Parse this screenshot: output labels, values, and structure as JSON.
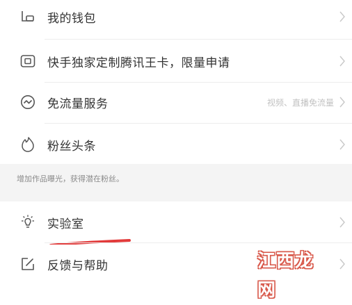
{
  "menu_top": {
    "items": [
      {
        "label": "我的钱包",
        "icon": "wallet-icon",
        "right_text": ""
      },
      {
        "label": "快手独家定制腾讯王卡，限量申请",
        "icon": "sim-card-icon",
        "right_text": ""
      },
      {
        "label": "免流量服务",
        "icon": "wave-circle-icon",
        "right_text": "视频、直播免流量"
      },
      {
        "label": "粉丝头条",
        "icon": "flame-icon",
        "right_text": ""
      }
    ]
  },
  "section_note": "增加作品曝光，获得潜在粉丝。",
  "menu_bottom": {
    "items": [
      {
        "label": "实验室",
        "icon": "lightbulb-icon"
      },
      {
        "label": "反馈与帮助",
        "icon": "edit-icon"
      }
    ]
  },
  "watermark": {
    "text": "江西龙网"
  },
  "colors": {
    "annotation_underline": "#e23b3b",
    "watermark_outline": "#d8584a",
    "section_background": "#f4f4f4"
  }
}
